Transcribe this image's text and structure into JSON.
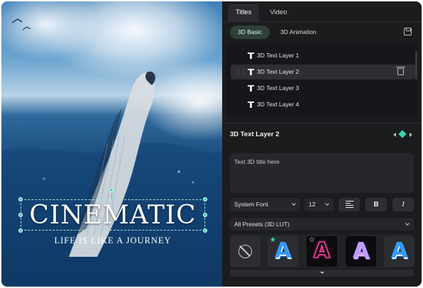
{
  "preview": {
    "title_text": "CINEMATIC",
    "subtitle_text": "LIFE IS LIKE A JOURNEY"
  },
  "tabs": [
    {
      "label": "Titles",
      "active": true
    },
    {
      "label": "Video",
      "active": false
    }
  ],
  "subtabs": [
    {
      "label": "3D Basic",
      "active": true
    },
    {
      "label": "3D Animation",
      "active": false
    }
  ],
  "layers": [
    {
      "name": "3D Text Layer 1",
      "selected": false
    },
    {
      "name": "3D Text Layer 2",
      "selected": true
    },
    {
      "name": "3D Text Layer 3",
      "selected": false
    },
    {
      "name": "3D Text Layer 4",
      "selected": false
    }
  ],
  "selected_layer": {
    "title": "3D Text Layer 2"
  },
  "text_input": {
    "placeholder": "Text 3D title here"
  },
  "font": {
    "family": "System Font",
    "size": "12"
  },
  "format_buttons": {
    "bold": "B",
    "italic": "I"
  },
  "preset_filter": {
    "selected": "All Presets (3D LUT)"
  },
  "presets": [
    {
      "name": "none"
    },
    {
      "letter": "A",
      "style": "blue-3d",
      "badge": "teal-star"
    },
    {
      "letter": "A",
      "style": "pink-outline",
      "badge": "outline-star"
    },
    {
      "letter": "A",
      "style": "purple-gradient"
    },
    {
      "letter": "A",
      "style": "blue-3d"
    }
  ],
  "colors": {
    "accent": "#39d6b4",
    "panel_bg": "#1b1c1e",
    "preset_blue": "#2f9bff",
    "preset_pink": "#ff3fa4",
    "preset_purple": "#b89cff"
  }
}
